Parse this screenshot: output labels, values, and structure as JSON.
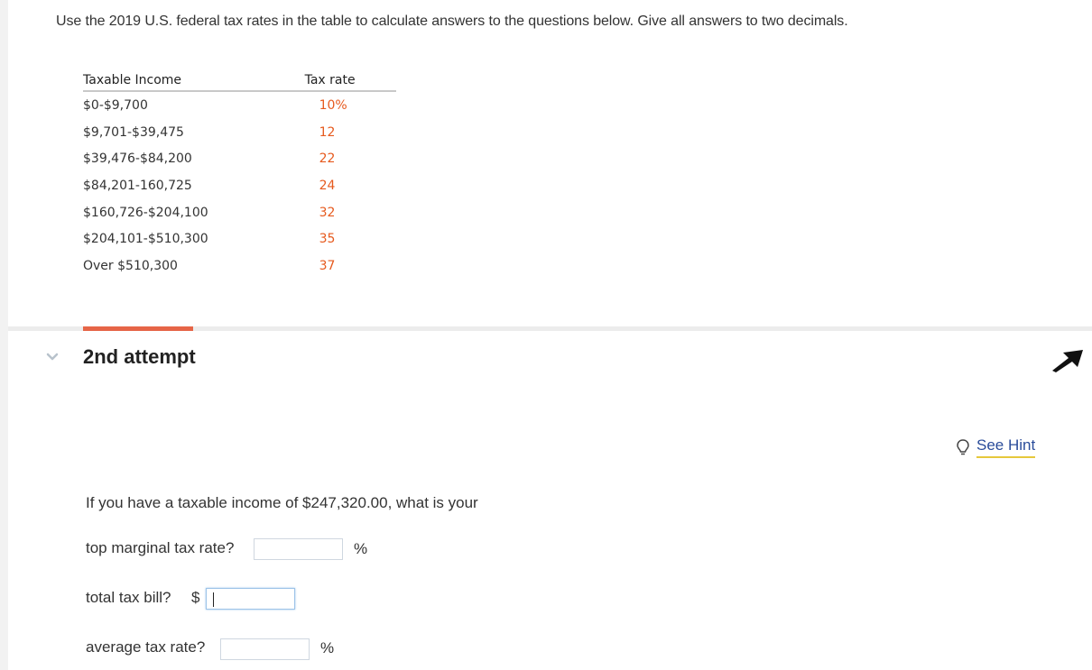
{
  "intro": "Use the 2019 U.S. federal tax rates in the table to calculate answers to the questions below. Give all answers to two decimals.",
  "table": {
    "headers": {
      "income": "Taxable Income",
      "rate": "Tax rate"
    },
    "rows": [
      {
        "income": "$0-$9,700",
        "rate": "10%"
      },
      {
        "income": "$9,701-$39,475",
        "rate": "12"
      },
      {
        "income": "$39,476-$84,200",
        "rate": "22"
      },
      {
        "income": "$84,201-160,725",
        "rate": "24"
      },
      {
        "income": "$160,726-$204,100",
        "rate": "32"
      },
      {
        "income": "$204,101-$510,300",
        "rate": "35"
      },
      {
        "income": "Over $510,300",
        "rate": "37"
      }
    ]
  },
  "attempt": {
    "title": "2nd attempt"
  },
  "hint": {
    "label": "See Hint"
  },
  "question": {
    "prompt": "If you have a taxable income of $247,320.00, what is your",
    "q1": {
      "label": "top marginal tax rate?",
      "unit": "%",
      "value": ""
    },
    "q2": {
      "label": "total tax bill?",
      "prefix": "$",
      "value": ""
    },
    "q3": {
      "label": "average tax rate?",
      "unit": "%",
      "value": ""
    }
  },
  "colors": {
    "accent": "#e66547",
    "rate_text": "#e65a1e",
    "link": "#2a4c9a",
    "hint_underline": "#e6c83c"
  }
}
